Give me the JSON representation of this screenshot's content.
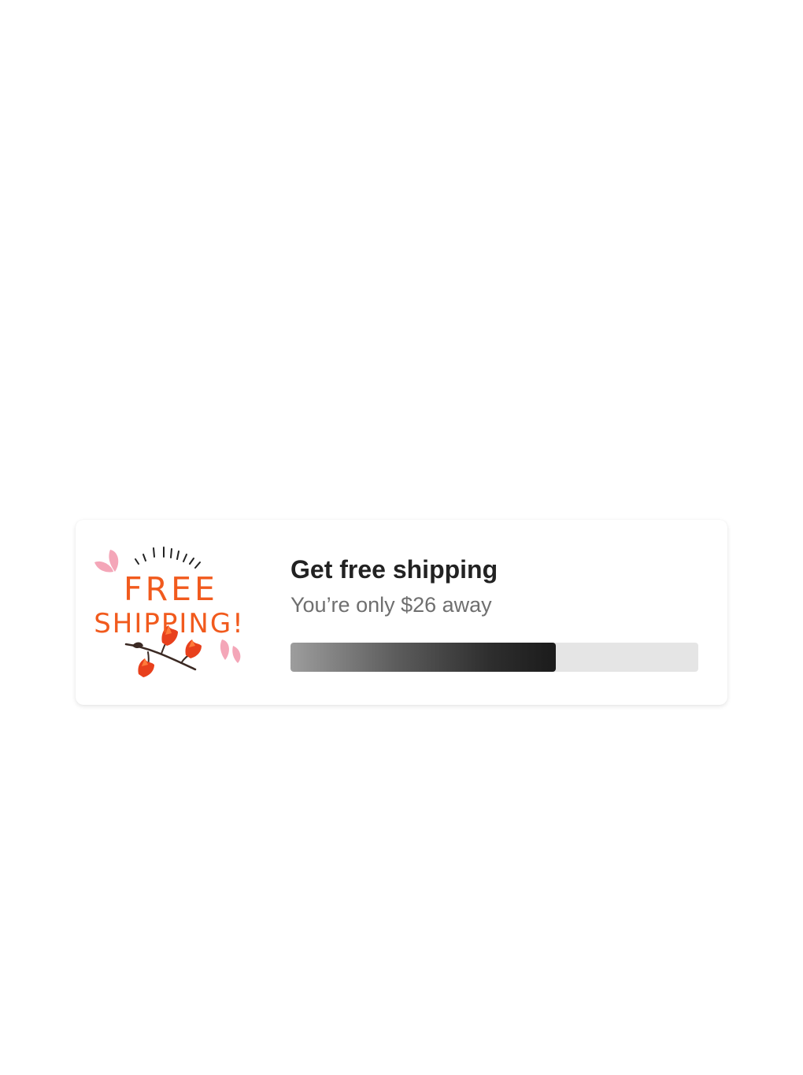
{
  "promo": {
    "badge": {
      "line1": "FREE",
      "line2": "SHIPPING!",
      "accent_color": "#f15a1d",
      "petal_color": "#f4a6b8",
      "icon": "flower-sprig-icon"
    },
    "title": "Get free shipping",
    "subtitle": "You’re only $26 away",
    "progress": {
      "fraction": 0.65,
      "fill_color": "#1b1b1b",
      "track_color": "#e5e5e5"
    }
  }
}
